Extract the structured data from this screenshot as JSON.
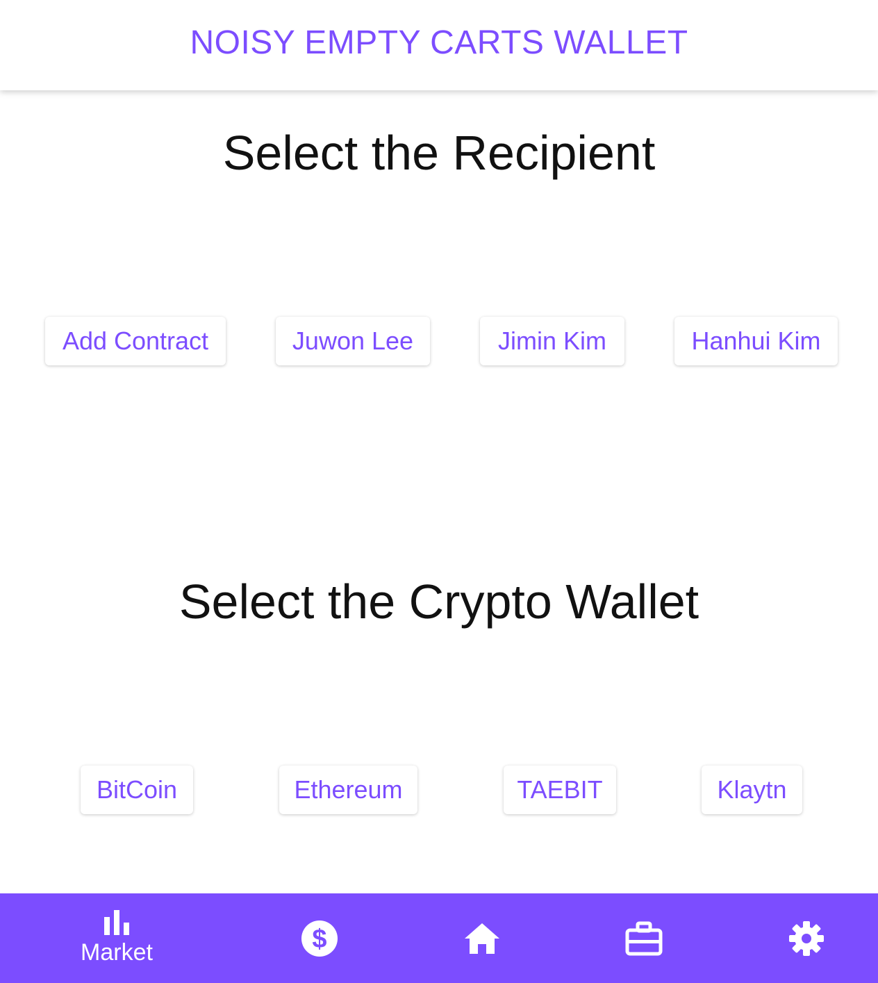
{
  "header": {
    "title": "NOISY EMPTY CARTS WALLET"
  },
  "recipient_section": {
    "title": "Select the Recipient",
    "options": [
      "Add Contract",
      "Juwon Lee",
      "Jimin Kim",
      "Hanhui Kim"
    ]
  },
  "wallet_section": {
    "title": "Select the Crypto Wallet",
    "options": [
      "BitCoin",
      "Ethereum",
      "TAEBIT",
      "Klaytn"
    ]
  },
  "bottom_nav": {
    "items": [
      {
        "icon": "bar-chart-icon",
        "label": "Market",
        "active": true
      },
      {
        "icon": "dollar-icon",
        "label": ""
      },
      {
        "icon": "home-icon",
        "label": ""
      },
      {
        "icon": "briefcase-icon",
        "label": ""
      },
      {
        "icon": "gear-icon",
        "label": ""
      }
    ]
  },
  "colors": {
    "accent": "#7c4dff",
    "background": "#ffffff",
    "heading_text": "#111111"
  }
}
